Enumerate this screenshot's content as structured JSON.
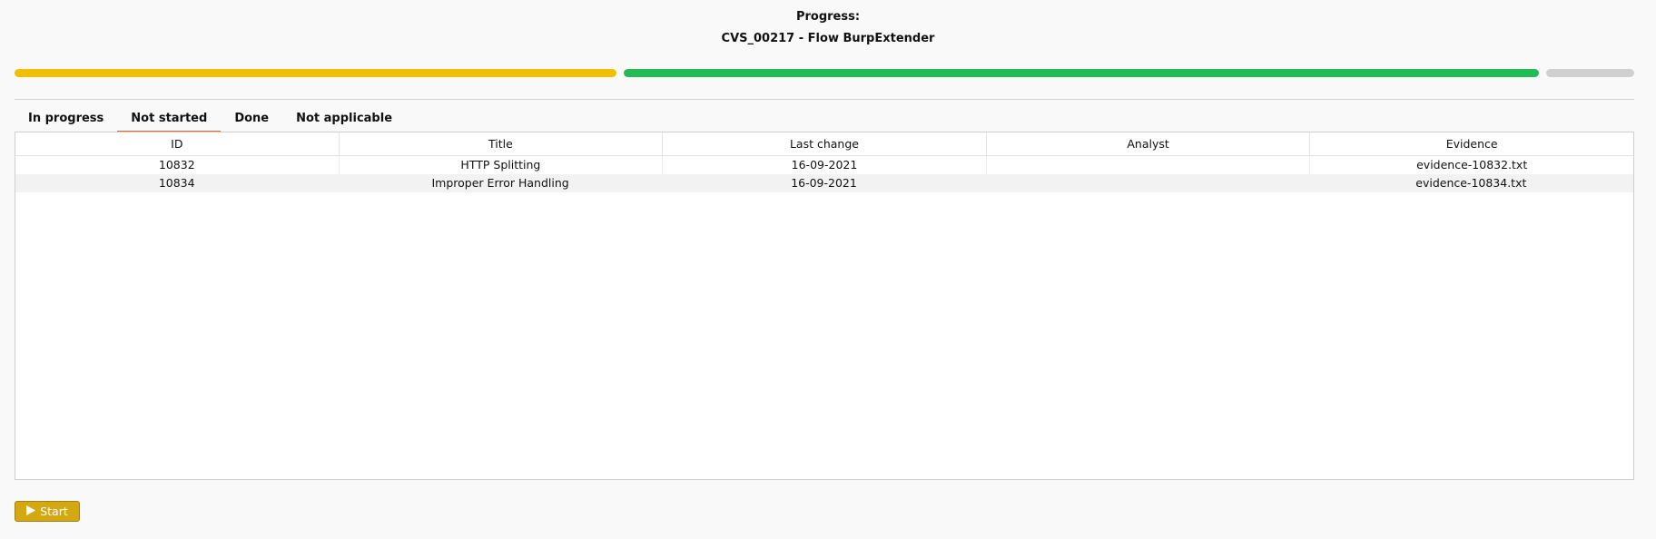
{
  "header": {
    "progress_label": "Progress:",
    "project_title": "CVS_00217 - Flow BurpExtender"
  },
  "progress": {
    "segments": [
      {
        "name": "in-progress",
        "fraction": 0.375,
        "color": "#f0c000"
      },
      {
        "name": "done",
        "fraction": 0.57,
        "color": "#22bb55"
      },
      {
        "name": "remaining",
        "fraction": 0.055,
        "color": "#d0d0d0"
      }
    ]
  },
  "tabs": [
    {
      "label": "In progress",
      "active": false
    },
    {
      "label": "Not started",
      "active": true
    },
    {
      "label": "Done",
      "active": false
    },
    {
      "label": "Not applicable",
      "active": false
    }
  ],
  "table": {
    "columns": [
      "ID",
      "Title",
      "Last change",
      "Analyst",
      "Evidence"
    ],
    "rows": [
      [
        "10832",
        "HTTP Splitting",
        "16-09-2021",
        "",
        "evidence-10832.txt"
      ],
      [
        "10834",
        "Improper Error Handling",
        "16-09-2021",
        "",
        "evidence-10834.txt"
      ]
    ]
  },
  "actions": {
    "start_label": "Start",
    "start_icon": "play-icon",
    "accent": "#d4a812"
  }
}
